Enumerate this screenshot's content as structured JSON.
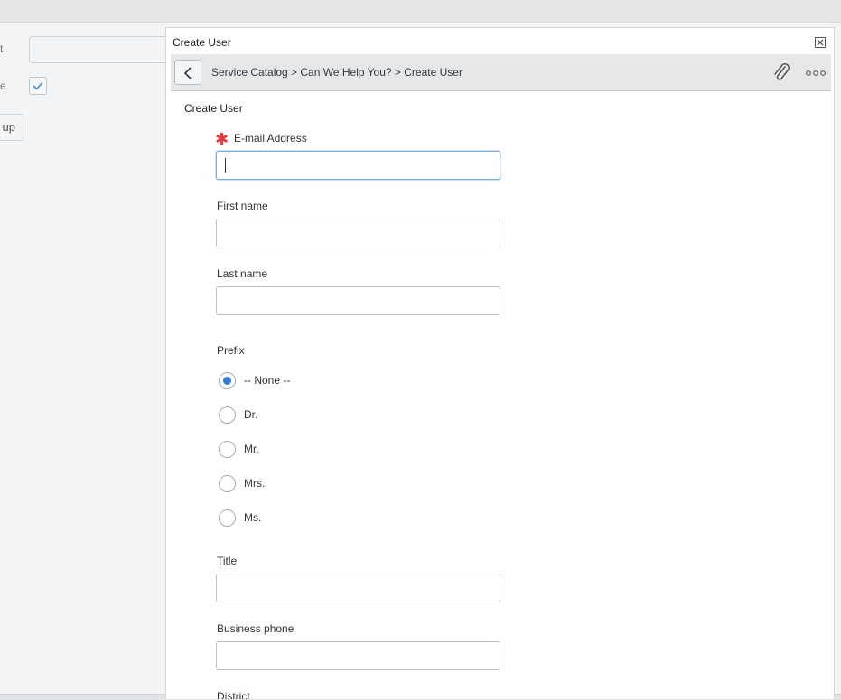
{
  "background": {
    "label_1": "t",
    "label_2": "e",
    "button_label": "up"
  },
  "modal": {
    "title": "Create User",
    "breadcrumb": "Service Catalog > Can We Help You?  > Create User",
    "section_title": "Create User"
  },
  "form": {
    "email_label": "E-mail Address",
    "email_value": "",
    "first_name_label": "First name",
    "last_name_label": "Last name",
    "prefix_label": "Prefix",
    "prefix_options": [
      "-- None --",
      "Dr.",
      "Mr.",
      "Mrs.",
      "Ms."
    ],
    "prefix_selected": "-- None --",
    "title_label": "Title",
    "business_phone_label": "Business phone",
    "next_label_partial": "District"
  },
  "colors": {
    "accent": "#2f7fd6",
    "required": "#e5383b"
  }
}
